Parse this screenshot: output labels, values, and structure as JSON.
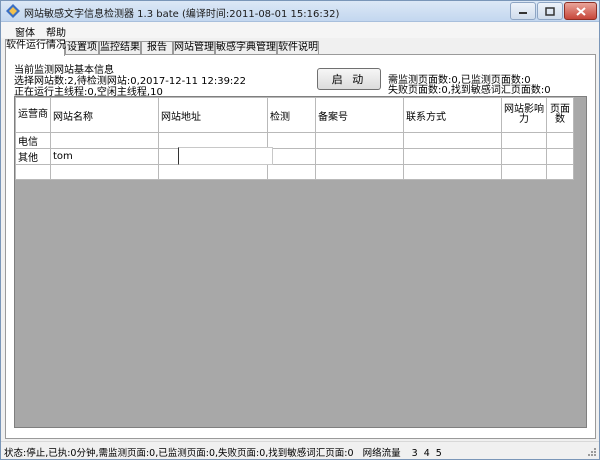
{
  "titlebar": {
    "title": "网站敏感文字信息检测器 1.3 bate (编译时间:2011-08-01 15:16:32)",
    "app_icon": "app-logo-icon",
    "minimize_icon": "minimize-icon",
    "maximize_icon": "maximize-icon",
    "close_icon": "close-icon"
  },
  "menu": {
    "items": [
      "窗体",
      "帮助"
    ]
  },
  "tabs": [
    {
      "label": "软件运行情况",
      "active": true
    },
    {
      "label": "设置项",
      "active": false
    },
    {
      "label": "监控结果",
      "active": false
    },
    {
      "label": "报告",
      "active": false
    },
    {
      "label": "网站管理",
      "active": false
    },
    {
      "label": "敏感字典管理",
      "active": false
    },
    {
      "label": "软件说明",
      "active": false
    }
  ],
  "info": {
    "section_title": "当前监测网站基本信息",
    "line1": "选择网站数:2,待检测网站:0,2017-12-11 12:39:22",
    "line2": "正在运行主线程:0,空闲主线程,10",
    "right_line1": "需监测页面数:0,已监测页面数:0",
    "right_line2": "失败页面数:0,找到敏感词汇页面数:0"
  },
  "start_button": {
    "label": "启 动"
  },
  "grid": {
    "headers": [
      "运营商",
      "网站名称",
      "网站地址",
      "检测",
      "备案号",
      "联系方式",
      "网站影响力",
      "页面数"
    ],
    "rows": [
      {
        "carrier": "电信",
        "site_name": "",
        "site_url": "",
        "check": "",
        "icp": "",
        "contact": "",
        "influence": "",
        "pages": ""
      },
      {
        "carrier": "其他",
        "site_name": "tom",
        "site_url": "",
        "check": "",
        "icp": "",
        "contact": "",
        "influence": "",
        "pages": ""
      },
      {
        "carrier": "",
        "site_name": "",
        "site_url": "",
        "check": "",
        "icp": "",
        "contact": "",
        "influence": "",
        "pages": ""
      }
    ]
  },
  "status": {
    "text": "状态:停止,已执:0分钟,需监测页面:0,已监测页面:0,失败页面:0,找到敏感词汇页面:0",
    "traffic_label": "网络流量",
    "traffic_values": "3  4  5"
  },
  "colors": {
    "window_border": "#7a96b8",
    "close_button": "#c7463a",
    "grid_background": "#a8a8a8"
  }
}
